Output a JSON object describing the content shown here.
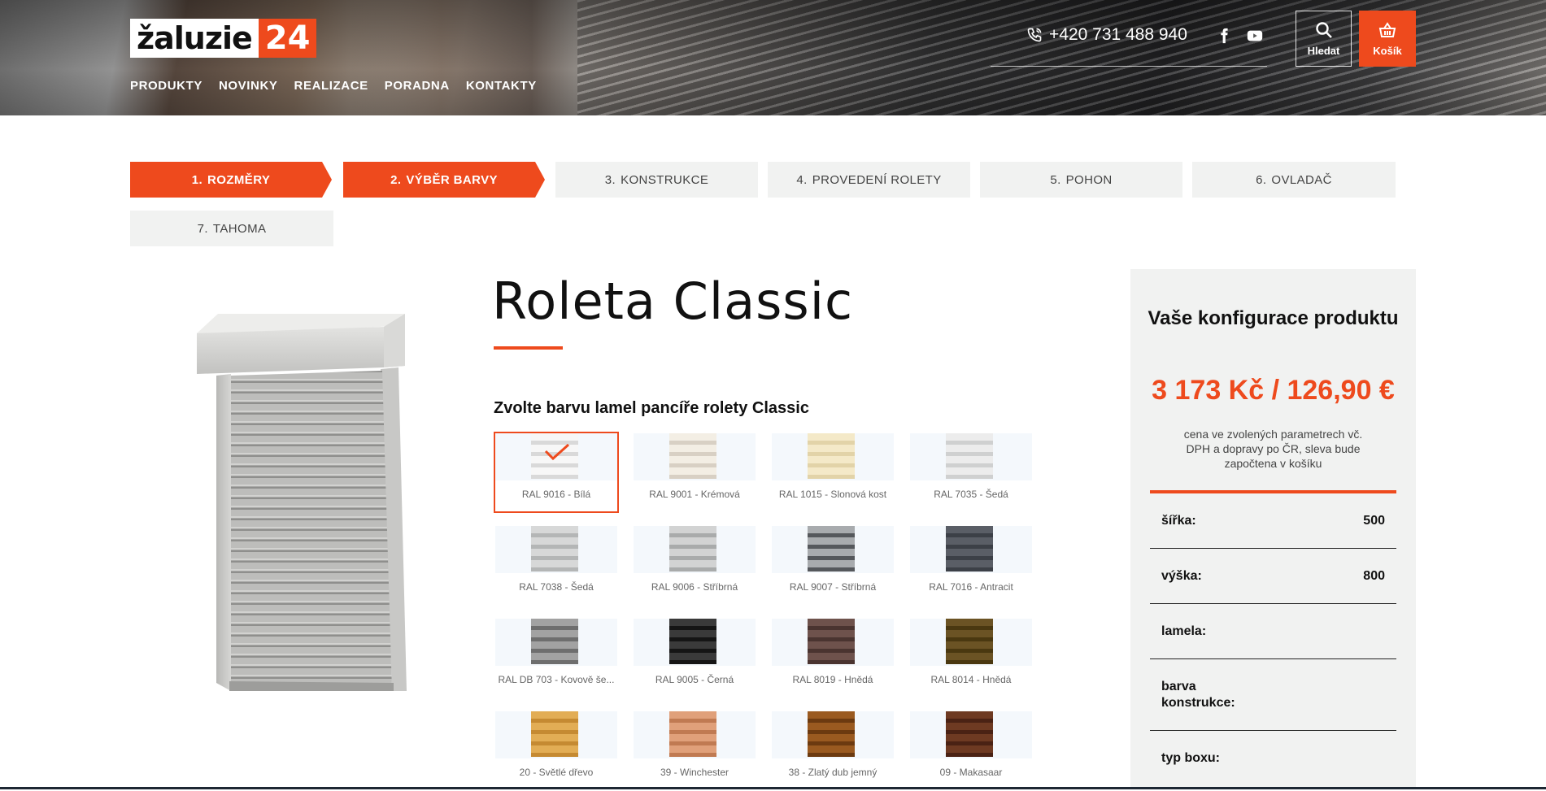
{
  "header": {
    "logo": {
      "word": "žaluzie",
      "number": "24"
    },
    "nav": [
      "PRODUKTY",
      "NOVINKY",
      "REALIZACE",
      "PORADNA",
      "KONTAKTY"
    ],
    "phone": "+420 731 488 940",
    "search_label": "Hledat",
    "cart_label": "Košík"
  },
  "steps": [
    {
      "num": "1.",
      "label": "ROZMĚRY",
      "state": "active"
    },
    {
      "num": "2.",
      "label": "VÝBĚR BARVY",
      "state": "active"
    },
    {
      "num": "3.",
      "label": "KONSTRUKCE",
      "state": "inactive"
    },
    {
      "num": "4.",
      "label": "PROVEDENÍ ROLETY",
      "state": "inactive"
    },
    {
      "num": "5.",
      "label": "POHON",
      "state": "inactive"
    },
    {
      "num": "6.",
      "label": "OVLADAČ",
      "state": "inactive"
    },
    {
      "num": "7.",
      "label": "TAHOMA",
      "state": "inactive"
    }
  ],
  "product": {
    "title": "Roleta Classic",
    "subtitle": "Zvolte barvu lamel pancíře rolety Classic"
  },
  "colors": [
    {
      "label": "RAL 9016 - Bílá",
      "c1": "#f7f7f7",
      "c2": "#d9d9d9",
      "selected": true
    },
    {
      "label": "RAL 9001 - Krémová",
      "c1": "#f3eee4",
      "c2": "#d8d0c4",
      "selected": false
    },
    {
      "label": "RAL 1015 - Slonová kost",
      "c1": "#f4e9c8",
      "c2": "#e2d3a8",
      "selected": false
    },
    {
      "label": "RAL 7035 - Šedá",
      "c1": "#ececec",
      "c2": "#cfd0d0",
      "selected": false
    },
    {
      "label": "RAL 7038 - Šedá",
      "c1": "#d7d8d8",
      "c2": "#b4b6b6",
      "selected": false
    },
    {
      "label": "RAL 9006 - Stříbrná",
      "c1": "#d2d3d3",
      "c2": "#a9abab",
      "selected": false
    },
    {
      "label": "RAL 9007 - Stříbrná",
      "c1": "#a8abae",
      "c2": "#55585c",
      "selected": false
    },
    {
      "label": "RAL 7016 - Antracit",
      "c1": "#5a5e66",
      "c2": "#3c4047",
      "selected": false
    },
    {
      "label": "RAL DB 703 - Kovově še...",
      "c1": "#a2a2a2",
      "c2": "#6e6e6e",
      "selected": false
    },
    {
      "label": "RAL 9005 - Černá",
      "c1": "#3a3a3a",
      "c2": "#151515",
      "selected": false
    },
    {
      "label": "RAL 8019 - Hnědá",
      "c1": "#6e524c",
      "c2": "#4a3430",
      "selected": false
    },
    {
      "label": "RAL 8014 - Hnědá",
      "c1": "#6b5324",
      "c2": "#4a3810",
      "selected": false
    },
    {
      "label": "20 - Světlé dřevo",
      "c1": "#e2ad55",
      "c2": "#c58a32",
      "selected": false
    },
    {
      "label": "39 - Winchester",
      "c1": "#e0a07a",
      "c2": "#c07a52",
      "selected": false
    },
    {
      "label": "38 - Zlatý dub jemný",
      "c1": "#9a5a20",
      "c2": "#6c3a10",
      "selected": false
    },
    {
      "label": "09 - Makasaar",
      "c1": "#6e3a22",
      "c2": "#4a2214",
      "selected": false
    }
  ],
  "config": {
    "title": "Vaše konfigurace produktu",
    "price": "3 173 Kč / 126,90 €",
    "note": "cena ve zvolených parametrech vč. DPH a dopravy po ČR, sleva bude započtena v košíku",
    "rows": [
      {
        "label": "šířka:",
        "value": "500"
      },
      {
        "label": "výška:",
        "value": "800"
      },
      {
        "label": "lamela:",
        "value": ""
      },
      {
        "label": "barva konstrukce:",
        "value": ""
      },
      {
        "label": "typ boxu:",
        "value": ""
      }
    ]
  },
  "icons": {
    "phone": "phone-icon",
    "facebook": "facebook-icon",
    "youtube": "youtube-icon",
    "search": "search-icon",
    "cart": "basket-icon",
    "check": "check-icon"
  },
  "accent_color": "#ee4a1d"
}
